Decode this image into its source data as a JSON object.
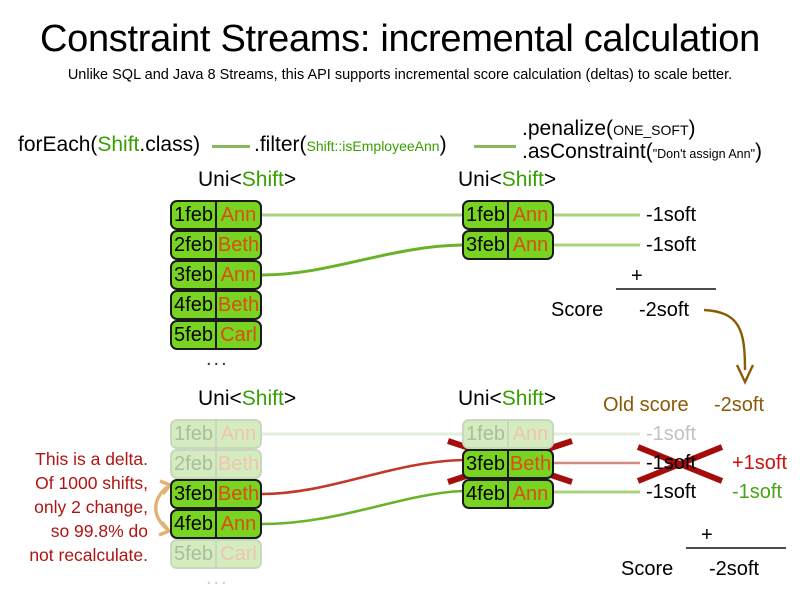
{
  "title": "Constraint Streams: incremental calculation",
  "subtitle": "Unlike SQL and Java 8 Streams, this API supports incremental score calculation (deltas) to scale better.",
  "code": {
    "for_each": "forEach(",
    "for_each_type": "Shift",
    "for_each_tail": ".class)",
    "filter": ".filter(",
    "filter_arg": "Shift::isEmployeeAnn",
    "filter_tail": ")",
    "penalize": ".penalize(",
    "penalize_arg": "ONE_SOFT",
    "penalize_tail": ")",
    "as_constraint": ".asConstraint(",
    "as_constraint_arg": "\"Don't assign Ann\"",
    "as_constraint_tail": ")"
  },
  "stream_label": {
    "prefix": "Uni<",
    "type": "Shift",
    "suffix": ">"
  },
  "top": {
    "source_stream": {
      "label": "Uni<Shift>",
      "rows": [
        {
          "date": "1feb",
          "employee": "Ann"
        },
        {
          "date": "2feb",
          "employee": "Beth"
        },
        {
          "date": "3feb",
          "employee": "Ann"
        },
        {
          "date": "4feb",
          "employee": "Beth"
        },
        {
          "date": "5feb",
          "employee": "Carl"
        }
      ],
      "ellipsis": "..."
    },
    "filtered_stream": {
      "label": "Uni<Shift>",
      "rows": [
        {
          "date": "1feb",
          "employee": "Ann",
          "score": "-1soft"
        },
        {
          "date": "3feb",
          "employee": "Ann",
          "score": "-1soft"
        }
      ]
    },
    "score_block": {
      "plus": "+",
      "score_word": "Score",
      "total": "-2soft"
    }
  },
  "bottom": {
    "delta_note": [
      "This is a delta.",
      "Of 1000 shifts,",
      "only 2 change,",
      "so 99.8% do",
      "not recalculate."
    ],
    "source_stream": {
      "label": "Uni<Shift>",
      "rows": [
        {
          "date": "1feb",
          "employee": "Ann",
          "faded": true
        },
        {
          "date": "2feb",
          "employee": "Beth",
          "faded": true
        },
        {
          "date": "3feb",
          "employee": "Beth",
          "faded": false
        },
        {
          "date": "4feb",
          "employee": "Ann",
          "faded": false
        },
        {
          "date": "5feb",
          "employee": "Carl",
          "faded": true
        }
      ],
      "ellipsis": "..."
    },
    "filtered_stream": {
      "label": "Uni<Shift>",
      "rows": [
        {
          "date": "1feb",
          "employee": "Ann",
          "faded": true,
          "score": "-1soft",
          "delta": ""
        },
        {
          "date": "3feb",
          "employee": "Beth",
          "faded": false,
          "struck": true,
          "score": "-1soft",
          "delta": "+1soft"
        },
        {
          "date": "4feb",
          "employee": "Ann",
          "faded": false,
          "score": "-1soft",
          "delta": "-1soft"
        }
      ]
    },
    "old_score": {
      "label": "Old score",
      "value": "-2soft"
    },
    "score_block": {
      "plus": "+",
      "score_word": "Score",
      "total": "-2soft"
    }
  },
  "colors": {
    "box_fill": "#78d420",
    "box_fill_faded": "#d5ecbe",
    "employee_text": "#d94d16",
    "generic_green": "#37a000",
    "old_score_brown": "#8a5a06",
    "delta_red": "#b01414",
    "strike_red": "#a50d0d",
    "delta_arrow_gold": "#e3b172"
  }
}
